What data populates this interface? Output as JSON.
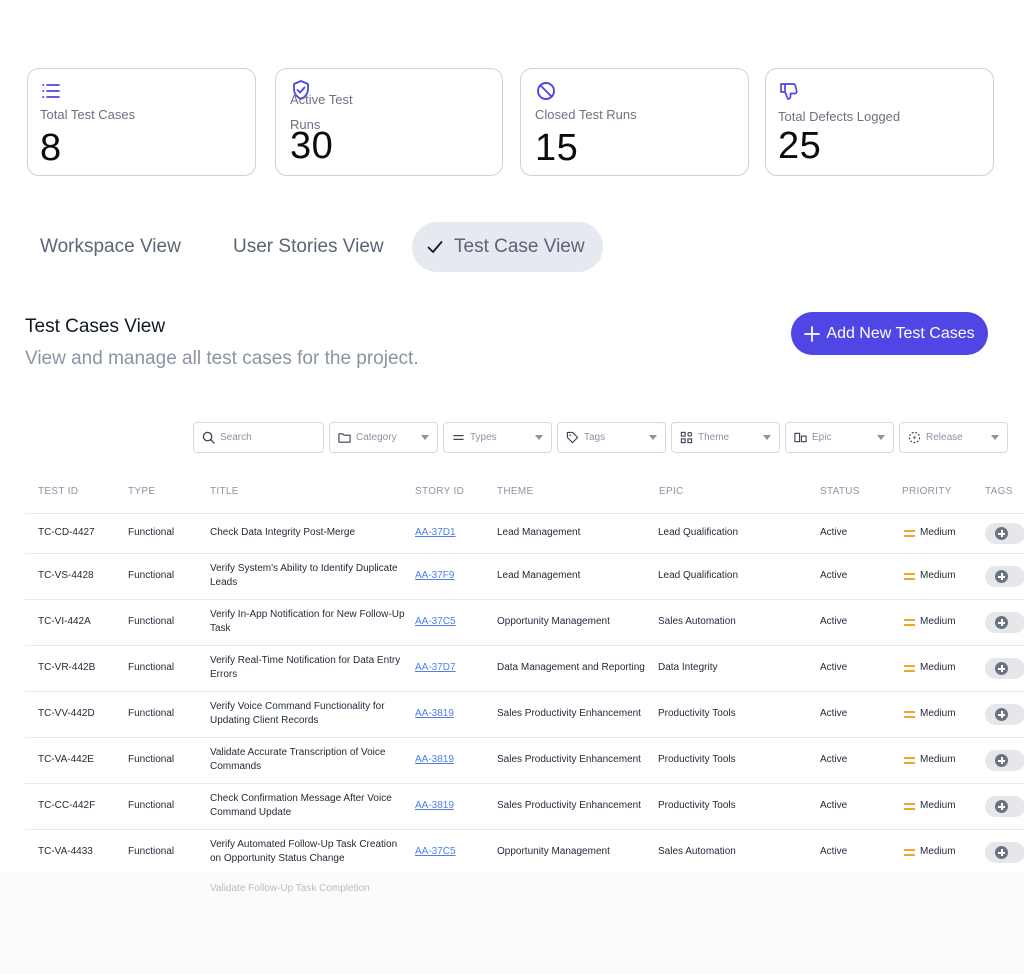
{
  "stats": [
    {
      "label": "Total Test Cases",
      "value": "8",
      "icon": "list-icon"
    },
    {
      "label": "Active Test Runs",
      "label_line1": "Active Test",
      "label_line2": "Runs",
      "value": "30",
      "icon": "shield-check-icon"
    },
    {
      "label": "Closed Test Runs",
      "value": "15",
      "icon": "ban-icon"
    },
    {
      "label": "Total Defects Logged",
      "value": "25",
      "icon": "thumbs-down-icon"
    }
  ],
  "tabs": [
    {
      "label": "Workspace View",
      "active": false
    },
    {
      "label": "User Stories View",
      "active": false
    },
    {
      "label": "Test Case View",
      "active": true
    }
  ],
  "section": {
    "title": "Test Cases View",
    "subtitle": "View and manage all test cases for the project.",
    "add_button": "Add New Test Cases"
  },
  "filters": {
    "search_placeholder": "Search",
    "category": "Category",
    "types": "Types",
    "tags": "Tags",
    "theme": "Theme",
    "epic": "Epic",
    "release": "Release"
  },
  "table": {
    "headers": [
      "TEST ID",
      "TYPE",
      "TITLE",
      "STORY ID",
      "THEME",
      "EPIC",
      "STATUS",
      "PRIORITY",
      "TAGS"
    ],
    "rows": [
      {
        "id": "TC-CD-4427",
        "type": "Functional",
        "title1": "Check Data Integrity Post-Merge",
        "title2": "",
        "story": "AA-37D1",
        "theme": "Lead Management",
        "epic": "Lead Qualification",
        "status": "Active",
        "priority": "Medium"
      },
      {
        "id": "TC-VS-4428",
        "type": "Functional",
        "title1": "Verify System's Ability to Identify Duplicate",
        "title2": "Leads",
        "story": "AA-37F9",
        "theme": "Lead Management",
        "epic": "Lead Qualification",
        "status": "Active",
        "priority": "Medium"
      },
      {
        "id": "TC-VI-442A",
        "type": "Functional",
        "title1": "Verify In-App Notification for New Follow-Up",
        "title2": "Task",
        "story": "AA-37C5",
        "theme": "Opportunity Management",
        "epic": "Sales Automation",
        "status": "Active",
        "priority": "Medium"
      },
      {
        "id": "TC-VR-442B",
        "type": "Functional",
        "title1": "Verify Real-Time Notification for Data Entry",
        "title2": "Errors",
        "story": "AA-37D7",
        "theme": "Data Management and Reporting",
        "epic": "Data Integrity",
        "status": "Active",
        "priority": "Medium"
      },
      {
        "id": "TC-VV-442D",
        "type": "Functional",
        "title1": "Verify Voice Command Functionality for",
        "title2": "Updating Client Records",
        "story": "AA-3819",
        "theme": "Sales Productivity Enhancement",
        "epic": "Productivity Tools",
        "status": "Active",
        "priority": "Medium"
      },
      {
        "id": "TC-VA-442E",
        "type": "Functional",
        "title1": "Validate Accurate Transcription of Voice",
        "title2": "Commands",
        "story": "AA-3819",
        "theme": "Sales Productivity Enhancement",
        "epic": "Productivity Tools",
        "status": "Active",
        "priority": "Medium"
      },
      {
        "id": "TC-CC-442F",
        "type": "Functional",
        "title1": "Check Confirmation Message After Voice",
        "title2": "Command Update",
        "story": "AA-3819",
        "theme": "Sales Productivity Enhancement",
        "epic": "Productivity Tools",
        "status": "Active",
        "priority": "Medium"
      },
      {
        "id": "TC-VA-4433",
        "type": "Functional",
        "title1": "Verify Automated Follow-Up Task Creation",
        "title2": "on Opportunity Status Change",
        "story": "AA-37C5",
        "theme": "Opportunity Management",
        "epic": "Sales Automation",
        "status": "Active",
        "priority": "Medium"
      }
    ],
    "partial_row_title": "Validate Follow-Up Task Completion"
  },
  "colors": {
    "accent": "#4f46e5",
    "priority_medium": "#f4a62a",
    "link": "#4f7df0"
  }
}
